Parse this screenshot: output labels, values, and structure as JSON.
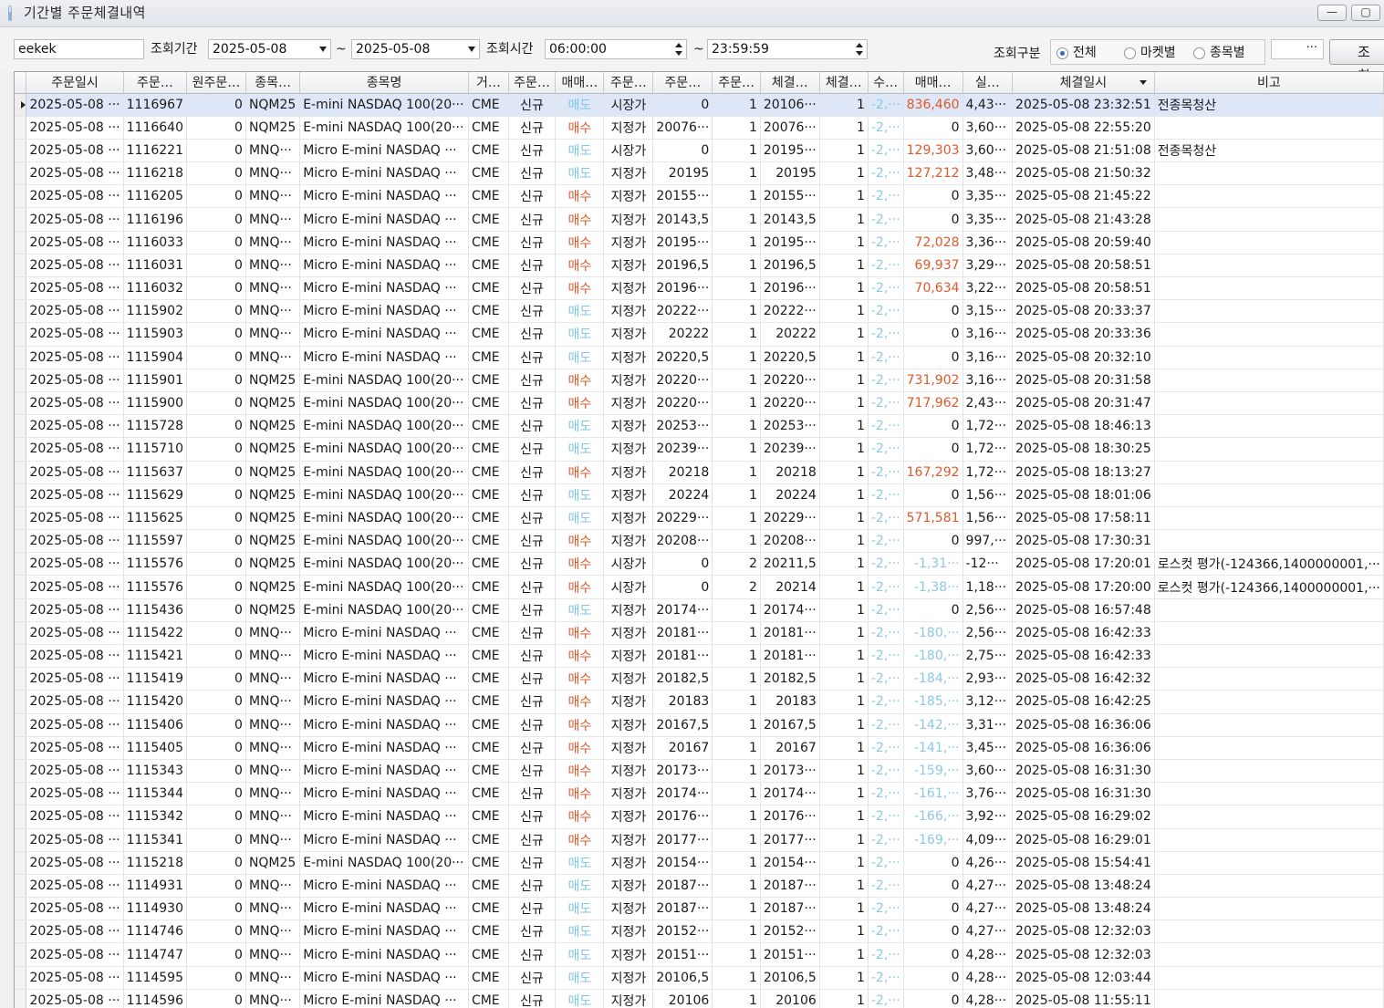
{
  "window": {
    "title": "기간별 주문체결내역",
    "min_label": "—",
    "max_label": "▢"
  },
  "toolbar": {
    "account": "eekek",
    "period_label": "조회기간",
    "date_from": "2025-05-08",
    "tilde1": "~",
    "date_to": "2025-05-08",
    "time_label": "조회시간",
    "time_from": "06:00:00",
    "tilde2": "~",
    "time_to": "23:59:59",
    "category_label": "조회구분",
    "radio_all": "전체",
    "radio_market": "마켓별",
    "radio_symbol": "종목별",
    "ellipsis": "···",
    "query_button": "조회"
  },
  "columns": [
    "주문일시",
    "주문…",
    "원주문…",
    "종목…",
    "종목명",
    "거…",
    "주문…",
    "매매…",
    "주문…",
    "주문…",
    "주문…",
    "체결…",
    "체결…",
    "수…",
    "매매…",
    "실…",
    "체결일시",
    "비고"
  ],
  "rows": [
    [
      "2025-05-08 ···",
      "1116967",
      "0",
      "NQM25",
      "E-mini NASDAQ 100(20···",
      "CME",
      "신규",
      "매도",
      "시장가",
      "0",
      "1",
      "20106···",
      "1",
      "-2,···",
      "836,460",
      "4,43···",
      "2025-05-08 23:32:51",
      "전종목청산"
    ],
    [
      "2025-05-08 ···",
      "1116640",
      "0",
      "NQM25",
      "E-mini NASDAQ 100(20···",
      "CME",
      "신규",
      "매수",
      "지정가",
      "20076···",
      "1",
      "20076···",
      "1",
      "-2,···",
      "0",
      "3,60···",
      "2025-05-08 22:55:20",
      ""
    ],
    [
      "2025-05-08 ···",
      "1116221",
      "0",
      "MNQ···",
      "Micro E-mini NASDAQ ···",
      "CME",
      "신규",
      "매도",
      "시장가",
      "0",
      "1",
      "20195···",
      "1",
      "-2,···",
      "129,303",
      "3,60···",
      "2025-05-08 21:51:08",
      "전종목청산"
    ],
    [
      "2025-05-08 ···",
      "1116218",
      "0",
      "MNQ···",
      "Micro E-mini NASDAQ ···",
      "CME",
      "신규",
      "매도",
      "지정가",
      "20195",
      "1",
      "20195",
      "1",
      "-2,···",
      "127,212",
      "3,48···",
      "2025-05-08 21:50:32",
      ""
    ],
    [
      "2025-05-08 ···",
      "1116205",
      "0",
      "MNQ···",
      "Micro E-mini NASDAQ ···",
      "CME",
      "신규",
      "매수",
      "지정가",
      "20155···",
      "1",
      "20155···",
      "1",
      "-2,···",
      "0",
      "3,35···",
      "2025-05-08 21:45:22",
      ""
    ],
    [
      "2025-05-08 ···",
      "1116196",
      "0",
      "MNQ···",
      "Micro E-mini NASDAQ ···",
      "CME",
      "신규",
      "매수",
      "지정가",
      "20143,5",
      "1",
      "20143,5",
      "1",
      "-2,···",
      "0",
      "3,35···",
      "2025-05-08 21:43:28",
      ""
    ],
    [
      "2025-05-08 ···",
      "1116033",
      "0",
      "MNQ···",
      "Micro E-mini NASDAQ ···",
      "CME",
      "신규",
      "매수",
      "지정가",
      "20195···",
      "1",
      "20195···",
      "1",
      "-2,···",
      "72,028",
      "3,36···",
      "2025-05-08 20:59:40",
      ""
    ],
    [
      "2025-05-08 ···",
      "1116031",
      "0",
      "MNQ···",
      "Micro E-mini NASDAQ ···",
      "CME",
      "신규",
      "매수",
      "지정가",
      "20196,5",
      "1",
      "20196,5",
      "1",
      "-2,···",
      "69,937",
      "3,29···",
      "2025-05-08 20:58:51",
      ""
    ],
    [
      "2025-05-08 ···",
      "1116032",
      "0",
      "MNQ···",
      "Micro E-mini NASDAQ ···",
      "CME",
      "신규",
      "매수",
      "지정가",
      "20196···",
      "1",
      "20196···",
      "1",
      "-2,···",
      "70,634",
      "3,22···",
      "2025-05-08 20:58:51",
      ""
    ],
    [
      "2025-05-08 ···",
      "1115902",
      "0",
      "MNQ···",
      "Micro E-mini NASDAQ ···",
      "CME",
      "신규",
      "매도",
      "지정가",
      "20222···",
      "1",
      "20222···",
      "1",
      "-2,···",
      "0",
      "3,15···",
      "2025-05-08 20:33:37",
      ""
    ],
    [
      "2025-05-08 ···",
      "1115903",
      "0",
      "MNQ···",
      "Micro E-mini NASDAQ ···",
      "CME",
      "신규",
      "매도",
      "지정가",
      "20222",
      "1",
      "20222",
      "1",
      "-2,···",
      "0",
      "3,16···",
      "2025-05-08 20:33:36",
      ""
    ],
    [
      "2025-05-08 ···",
      "1115904",
      "0",
      "MNQ···",
      "Micro E-mini NASDAQ ···",
      "CME",
      "신규",
      "매도",
      "지정가",
      "20220,5",
      "1",
      "20220,5",
      "1",
      "-2,···",
      "0",
      "3,16···",
      "2025-05-08 20:32:10",
      ""
    ],
    [
      "2025-05-08 ···",
      "1115901",
      "0",
      "NQM25",
      "E-mini NASDAQ 100(20···",
      "CME",
      "신규",
      "매수",
      "지정가",
      "20220···",
      "1",
      "20220···",
      "1",
      "-2,···",
      "731,902",
      "3,16···",
      "2025-05-08 20:31:58",
      ""
    ],
    [
      "2025-05-08 ···",
      "1115900",
      "0",
      "NQM25",
      "E-mini NASDAQ 100(20···",
      "CME",
      "신규",
      "매수",
      "지정가",
      "20220···",
      "1",
      "20220···",
      "1",
      "-2,···",
      "717,962",
      "2,43···",
      "2025-05-08 20:31:47",
      ""
    ],
    [
      "2025-05-08 ···",
      "1115728",
      "0",
      "NQM25",
      "E-mini NASDAQ 100(20···",
      "CME",
      "신규",
      "매도",
      "지정가",
      "20253···",
      "1",
      "20253···",
      "1",
      "-2,···",
      "0",
      "1,72···",
      "2025-05-08 18:46:13",
      ""
    ],
    [
      "2025-05-08 ···",
      "1115710",
      "0",
      "NQM25",
      "E-mini NASDAQ 100(20···",
      "CME",
      "신규",
      "매도",
      "지정가",
      "20239···",
      "1",
      "20239···",
      "1",
      "-2,···",
      "0",
      "1,72···",
      "2025-05-08 18:30:25",
      ""
    ],
    [
      "2025-05-08 ···",
      "1115637",
      "0",
      "NQM25",
      "E-mini NASDAQ 100(20···",
      "CME",
      "신규",
      "매수",
      "지정가",
      "20218",
      "1",
      "20218",
      "1",
      "-2,···",
      "167,292",
      "1,72···",
      "2025-05-08 18:13:27",
      ""
    ],
    [
      "2025-05-08 ···",
      "1115629",
      "0",
      "NQM25",
      "E-mini NASDAQ 100(20···",
      "CME",
      "신규",
      "매도",
      "지정가",
      "20224",
      "1",
      "20224",
      "1",
      "-2,···",
      "0",
      "1,56···",
      "2025-05-08 18:01:06",
      ""
    ],
    [
      "2025-05-08 ···",
      "1115625",
      "0",
      "NQM25",
      "E-mini NASDAQ 100(20···",
      "CME",
      "신규",
      "매도",
      "지정가",
      "20229···",
      "1",
      "20229···",
      "1",
      "-2,···",
      "571,581",
      "1,56···",
      "2025-05-08 17:58:11",
      ""
    ],
    [
      "2025-05-08 ···",
      "1115597",
      "0",
      "NQM25",
      "E-mini NASDAQ 100(20···",
      "CME",
      "신규",
      "매수",
      "지정가",
      "20208···",
      "1",
      "20208···",
      "1",
      "-2,···",
      "0",
      "997,···",
      "2025-05-08 17:30:31",
      ""
    ],
    [
      "2025-05-08 ···",
      "1115576",
      "0",
      "NQM25",
      "E-mini NASDAQ 100(20···",
      "CME",
      "신규",
      "매수",
      "시장가",
      "0",
      "2",
      "20211,5",
      "1",
      "-2,···",
      "-1,31···",
      "-12···",
      "2025-05-08 17:20:01",
      "로스컷 평가(-124366,1400000001,···"
    ],
    [
      "2025-05-08 ···",
      "1115576",
      "0",
      "NQM25",
      "E-mini NASDAQ 100(20···",
      "CME",
      "신규",
      "매수",
      "시장가",
      "0",
      "2",
      "20214",
      "1",
      "-2,···",
      "-1,38···",
      "1,18···",
      "2025-05-08 17:20:00",
      "로스컷 평가(-124366,1400000001,···"
    ],
    [
      "2025-05-08 ···",
      "1115436",
      "0",
      "NQM25",
      "E-mini NASDAQ 100(20···",
      "CME",
      "신규",
      "매도",
      "지정가",
      "20174···",
      "1",
      "20174···",
      "1",
      "-2,···",
      "0",
      "2,56···",
      "2025-05-08 16:57:48",
      ""
    ],
    [
      "2025-05-08 ···",
      "1115422",
      "0",
      "MNQ···",
      "Micro E-mini NASDAQ ···",
      "CME",
      "신규",
      "매수",
      "지정가",
      "20181···",
      "1",
      "20181···",
      "1",
      "-2,···",
      "-180,···",
      "2,56···",
      "2025-05-08 16:42:33",
      ""
    ],
    [
      "2025-05-08 ···",
      "1115421",
      "0",
      "MNQ···",
      "Micro E-mini NASDAQ ···",
      "CME",
      "신규",
      "매수",
      "지정가",
      "20181···",
      "1",
      "20181···",
      "1",
      "-2,···",
      "-180,···",
      "2,75···",
      "2025-05-08 16:42:33",
      ""
    ],
    [
      "2025-05-08 ···",
      "1115419",
      "0",
      "MNQ···",
      "Micro E-mini NASDAQ ···",
      "CME",
      "신규",
      "매수",
      "지정가",
      "20182,5",
      "1",
      "20182,5",
      "1",
      "-2,···",
      "-184,···",
      "2,93···",
      "2025-05-08 16:42:32",
      ""
    ],
    [
      "2025-05-08 ···",
      "1115420",
      "0",
      "MNQ···",
      "Micro E-mini NASDAQ ···",
      "CME",
      "신규",
      "매수",
      "지정가",
      "20183",
      "1",
      "20183",
      "1",
      "-2,···",
      "-185,···",
      "3,12···",
      "2025-05-08 16:42:25",
      ""
    ],
    [
      "2025-05-08 ···",
      "1115406",
      "0",
      "MNQ···",
      "Micro E-mini NASDAQ ···",
      "CME",
      "신규",
      "매수",
      "지정가",
      "20167,5",
      "1",
      "20167,5",
      "1",
      "-2,···",
      "-142,···",
      "3,31···",
      "2025-05-08 16:36:06",
      ""
    ],
    [
      "2025-05-08 ···",
      "1115405",
      "0",
      "MNQ···",
      "Micro E-mini NASDAQ ···",
      "CME",
      "신규",
      "매수",
      "지정가",
      "20167",
      "1",
      "20167",
      "1",
      "-2,···",
      "-141,···",
      "3,45···",
      "2025-05-08 16:36:06",
      ""
    ],
    [
      "2025-05-08 ···",
      "1115343",
      "0",
      "MNQ···",
      "Micro E-mini NASDAQ ···",
      "CME",
      "신규",
      "매수",
      "지정가",
      "20173···",
      "1",
      "20173···",
      "1",
      "-2,···",
      "-159,···",
      "3,60···",
      "2025-05-08 16:31:30",
      ""
    ],
    [
      "2025-05-08 ···",
      "1115344",
      "0",
      "MNQ···",
      "Micro E-mini NASDAQ ···",
      "CME",
      "신규",
      "매수",
      "지정가",
      "20174···",
      "1",
      "20174···",
      "1",
      "-2,···",
      "-161,···",
      "3,76···",
      "2025-05-08 16:31:30",
      ""
    ],
    [
      "2025-05-08 ···",
      "1115342",
      "0",
      "MNQ···",
      "Micro E-mini NASDAQ ···",
      "CME",
      "신규",
      "매수",
      "지정가",
      "20176···",
      "1",
      "20176···",
      "1",
      "-2,···",
      "-166,···",
      "3,92···",
      "2025-05-08 16:29:02",
      ""
    ],
    [
      "2025-05-08 ···",
      "1115341",
      "0",
      "MNQ···",
      "Micro E-mini NASDAQ ···",
      "CME",
      "신규",
      "매수",
      "지정가",
      "20177···",
      "1",
      "20177···",
      "1",
      "-2,···",
      "-169,···",
      "4,09···",
      "2025-05-08 16:29:01",
      ""
    ],
    [
      "2025-05-08 ···",
      "1115218",
      "0",
      "NQM25",
      "E-mini NASDAQ 100(20···",
      "CME",
      "신규",
      "매도",
      "지정가",
      "20154···",
      "1",
      "20154···",
      "1",
      "-2,···",
      "0",
      "4,26···",
      "2025-05-08 15:54:41",
      ""
    ],
    [
      "2025-05-08 ···",
      "1114931",
      "0",
      "MNQ···",
      "Micro E-mini NASDAQ ···",
      "CME",
      "신규",
      "매도",
      "지정가",
      "20187···",
      "1",
      "20187···",
      "1",
      "-2,···",
      "0",
      "4,27···",
      "2025-05-08 13:48:24",
      ""
    ],
    [
      "2025-05-08 ···",
      "1114930",
      "0",
      "MNQ···",
      "Micro E-mini NASDAQ ···",
      "CME",
      "신규",
      "매도",
      "지정가",
      "20187···",
      "1",
      "20187···",
      "1",
      "-2,···",
      "0",
      "4,27···",
      "2025-05-08 13:48:24",
      ""
    ],
    [
      "2025-05-08 ···",
      "1114746",
      "0",
      "MNQ···",
      "Micro E-mini NASDAQ ···",
      "CME",
      "신규",
      "매도",
      "지정가",
      "20152···",
      "1",
      "20152···",
      "1",
      "-2,···",
      "0",
      "4,27···",
      "2025-05-08 12:32:03",
      ""
    ],
    [
      "2025-05-08 ···",
      "1114747",
      "0",
      "MNQ···",
      "Micro E-mini NASDAQ ···",
      "CME",
      "신규",
      "매도",
      "지정가",
      "20151···",
      "1",
      "20151···",
      "1",
      "-2,···",
      "0",
      "4,28···",
      "2025-05-08 12:32:03",
      ""
    ],
    [
      "2025-05-08 ···",
      "1114595",
      "0",
      "MNQ···",
      "Micro E-mini NASDAQ ···",
      "CME",
      "신규",
      "매도",
      "지정가",
      "20106,5",
      "1",
      "20106,5",
      "1",
      "-2,···",
      "0",
      "4,28···",
      "2025-05-08 12:03:44",
      ""
    ],
    [
      "2025-05-08 ···",
      "1114596",
      "0",
      "MNQ···",
      "Micro E-mini NASDAQ ···",
      "CME",
      "신규",
      "매도",
      "지정가",
      "20106",
      "1",
      "20106",
      "1",
      "-2,···",
      "0",
      "4,28···",
      "2025-05-08 11:55:11",
      ""
    ]
  ],
  "colors": {
    "buy": "#e0582a",
    "sell": "#7ec6e8",
    "negative": "#8cc8e6",
    "selected_row": "#dde7f8"
  }
}
